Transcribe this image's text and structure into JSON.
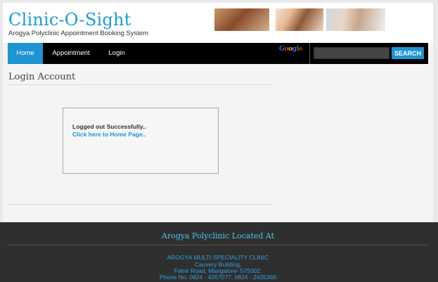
{
  "header": {
    "title": "Clinic-O-Sight",
    "subtitle": "Arogya Polyclinic Appointment Booking System"
  },
  "nav": {
    "items": [
      {
        "label": "Home"
      },
      {
        "label": "Appointment"
      },
      {
        "label": "Login"
      }
    ],
    "google_logo": "Google",
    "search": {
      "value": "",
      "placeholder": "",
      "button_label": "SEARCH"
    }
  },
  "main": {
    "heading": "Login Account",
    "message": "Logged out Successfully..",
    "home_link": "Click here to Home Page.."
  },
  "footer": {
    "title": "Arogya Polyclinic Located At",
    "address_lines": [
      "AROGYA MULTI-SPECIALITY CLINIC",
      "Cauvery Building,",
      "Falnir Road, Mangalore- 575002.",
      "Phone No: 0824 - 4267077, 0824 - 2435366"
    ]
  },
  "colors": {
    "accent": "#1e94d2",
    "navbar": "#000000",
    "footer": "#2f2f2f"
  }
}
